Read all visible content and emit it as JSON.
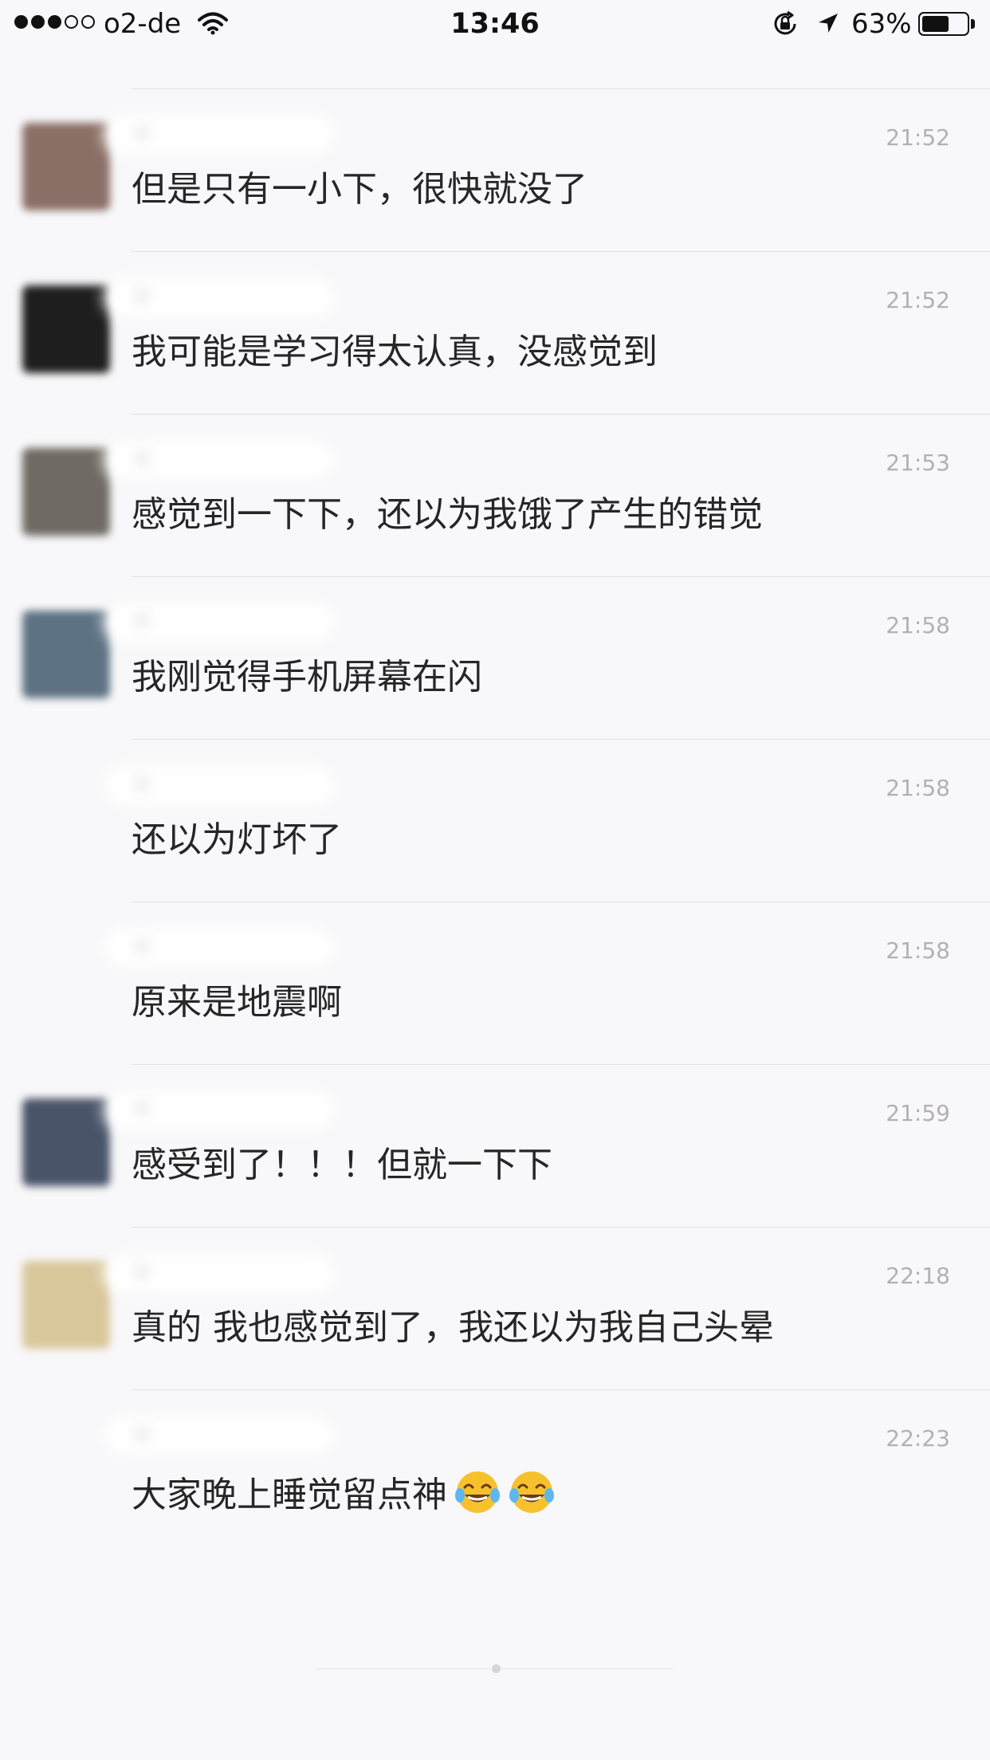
{
  "status_bar": {
    "carrier": "o2-de",
    "time": "13:46",
    "battery_percent": "63%",
    "battery_level": 0.63,
    "signal_bars_filled": 3,
    "signal_bars_total": 5,
    "icons": [
      "wifi-icon",
      "rotation-lock-icon",
      "location-arrow-icon",
      "battery-icon"
    ]
  },
  "messages": [
    {
      "time": "21:52",
      "text": "但是只有一小下，很快就没了",
      "has_avatar": true,
      "avatar_color": "#8a6f66"
    },
    {
      "time": "21:52",
      "text": "我可能是学习得太认真，没感觉到",
      "has_avatar": true,
      "avatar_color": "#1e1e1e"
    },
    {
      "time": "21:53",
      "text": "感觉到一下下，还以为我饿了产生的错觉",
      "has_avatar": true,
      "avatar_color": "#6f6a63"
    },
    {
      "time": "21:58",
      "text": "我刚觉得手机屏幕在闪",
      "has_avatar": true,
      "avatar_color": "#5d7283"
    },
    {
      "time": "21:58",
      "text": "还以为灯坏了",
      "has_avatar": false
    },
    {
      "time": "21:58",
      "text": "原来是地震啊",
      "has_avatar": false
    },
    {
      "time": "21:59",
      "text": "感受到了！！！但就一下下",
      "has_avatar": true,
      "avatar_color": "#49546a"
    },
    {
      "time": "22:18",
      "text": "真的  我也感觉到了，我还以为我自己头晕",
      "has_avatar": true,
      "avatar_color": "#d9c79b"
    },
    {
      "time": "22:23",
      "text": "大家晚上睡觉留点神",
      "has_avatar": false,
      "emoji": "face-with-tears-of-joy-icon",
      "emoji_count": 2
    }
  ]
}
